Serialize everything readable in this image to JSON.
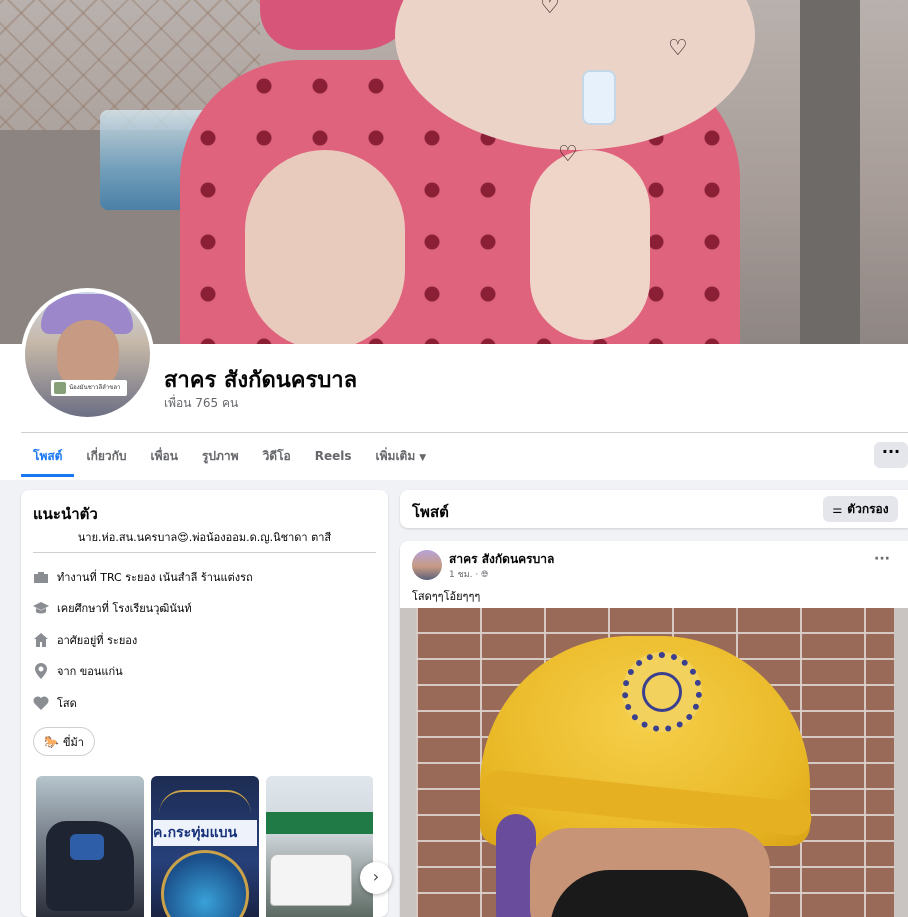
{
  "profile": {
    "name": "สาคร สังกัดนครบาล",
    "friends": "เพื่อน 765 คน",
    "avatar_badge": "น้องมันชาวลีลำขลา"
  },
  "tabs": [
    {
      "label": "โพสต์"
    },
    {
      "label": "เกี่ยวกับ"
    },
    {
      "label": "เพื่อน"
    },
    {
      "label": "รูปภาพ"
    },
    {
      "label": "วิดีโอ"
    },
    {
      "label": "Reels"
    },
    {
      "label": "เพิ่มเติม"
    }
  ],
  "more_button": "···",
  "intro": {
    "title": "แนะนำตัว",
    "bio": "นาย.ห่อ.สน.นครบาล😍.พ่อน้องออม.ด.ญ.นิชาดา ตาสี",
    "details": [
      {
        "icon": "briefcase-icon",
        "text": "ทำงานที่ TRC ระยอง เน้นสำลี ร้านแต่งรถ"
      },
      {
        "icon": "graduation-cap-icon",
        "text": "เคยศึกษาที่ โรงเรียนวุฒินันท์"
      },
      {
        "icon": "home-icon",
        "text": "อาศัยอยู่ที่ ระยอง"
      },
      {
        "icon": "location-pin-icon",
        "text": "จาก ขอนแก่น"
      },
      {
        "icon": "heart-icon",
        "text": "โสด"
      }
    ],
    "hobby": "ขี่ม้า",
    "hobby_icon": "🐎",
    "photo_banner": "ค.กระทุ่มแบน"
  },
  "posts_section": {
    "title": "โพสต์",
    "filter_label": "ตัวกรอง"
  },
  "post": {
    "author": "สาคร สังกัดนครบาล",
    "time": "1 ชม. · ",
    "text": "โสดๆๆโอ้ยๆๆๆ",
    "menu": "···"
  },
  "colors": {
    "accent": "#1877f2",
    "page_bg": "#f0f2f5",
    "secondary_text": "#65676b"
  }
}
